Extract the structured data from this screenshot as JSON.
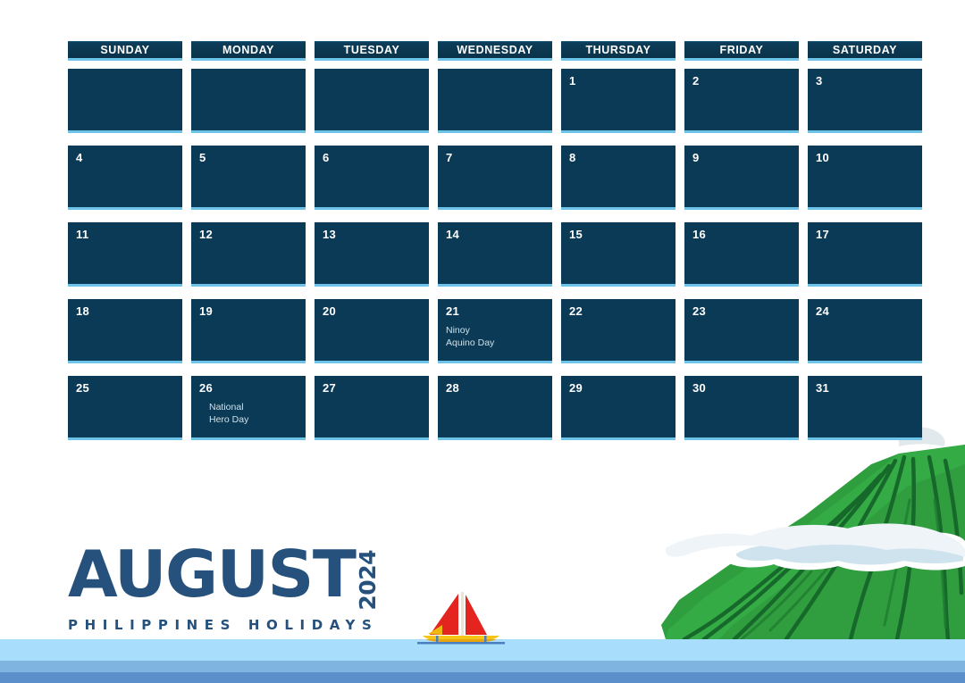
{
  "calendar": {
    "month": "AUGUST",
    "year": "2024",
    "subtitle": "PHILIPPINES HOLIDAYS",
    "weekday_headers": [
      "SUNDAY",
      "MONDAY",
      "TUESDAY",
      "WEDNESDAY",
      "THURSDAY",
      "FRIDAY",
      "SATURDAY"
    ],
    "weeks": [
      [
        {
          "day": ""
        },
        {
          "day": ""
        },
        {
          "day": ""
        },
        {
          "day": ""
        },
        {
          "day": "1"
        },
        {
          "day": "2"
        },
        {
          "day": "3"
        }
      ],
      [
        {
          "day": "4"
        },
        {
          "day": "5"
        },
        {
          "day": "6"
        },
        {
          "day": "7"
        },
        {
          "day": "8"
        },
        {
          "day": "9"
        },
        {
          "day": "10"
        }
      ],
      [
        {
          "day": "11"
        },
        {
          "day": "12"
        },
        {
          "day": "13"
        },
        {
          "day": "14"
        },
        {
          "day": "15"
        },
        {
          "day": "16"
        },
        {
          "day": "17"
        }
      ],
      [
        {
          "day": "18"
        },
        {
          "day": "19"
        },
        {
          "day": "20"
        },
        {
          "day": "21",
          "holiday": "Ninoy\nAquino Day"
        },
        {
          "day": "22"
        },
        {
          "day": "23"
        },
        {
          "day": "24"
        }
      ],
      [
        {
          "day": "25"
        },
        {
          "day": "26",
          "holiday": "National\nHero Day",
          "holiday_indent": true
        },
        {
          "day": "27"
        },
        {
          "day": "28"
        },
        {
          "day": "29"
        },
        {
          "day": "30"
        },
        {
          "day": "31"
        }
      ]
    ]
  },
  "illustration": {
    "mountain_label": "green-volcano",
    "boat_label": "red-sail-boat",
    "cloud_label": "cloud-band",
    "water_label": "sea-water-bands"
  },
  "colors": {
    "cell_navy": "#0b3a56",
    "cell_accent": "#6ec4e8",
    "title_blue": "#25517c",
    "holiday_text": "#cfe0e9",
    "water_light": "#a8ddfb",
    "water_mid": "#7fb4e0",
    "water_dark": "#5b8fcb",
    "mountain_green": "#2e9e3e",
    "mountain_dark": "#18702a",
    "sail_red": "#e3241f",
    "hull_yellow": "#f5c518"
  }
}
